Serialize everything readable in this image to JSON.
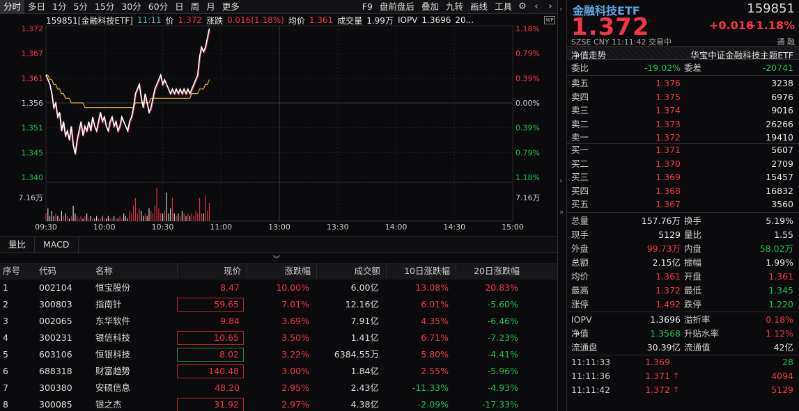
{
  "toolbar": {
    "periods": [
      "分时",
      "多日",
      "1分",
      "5分",
      "15分",
      "30分",
      "60分",
      "日",
      "周",
      "月",
      "更多"
    ],
    "tools": [
      "F9",
      "盘前盘后",
      "叠加",
      "九转",
      "画线",
      "工具"
    ]
  },
  "info": {
    "code_name": "159851[金融科技ETF]",
    "time": "11:11",
    "price_label": "价",
    "price": "1.372",
    "chg_label": "涨跌",
    "chg": "0.016(1.18%)",
    "avg_label": "均价",
    "avg": "1.361",
    "vol_label": "成交量",
    "vol": "1.99万",
    "iopv_label": "IOPV",
    "iopv": "1.3696",
    "extra": "20..."
  },
  "chart_data": {
    "type": "line",
    "x_ticks": [
      "09:30",
      "10:00",
      "10:30",
      "11:00",
      "13:00",
      "13:30",
      "14:00",
      "14:30",
      "15:00"
    ],
    "y_left_ticks": [
      "1.372",
      "1.367",
      "1.361",
      "1.356",
      "1.351",
      "1.345",
      "1.340"
    ],
    "y_right_ticks": [
      "1.18%",
      "0.79%",
      "0.39%",
      "0.00%",
      "0.39%",
      "0.79%",
      "1.18%"
    ],
    "vol_tick": "7.16万",
    "ylim": [
      1.34,
      1.372
    ],
    "price": [
      1.362,
      1.361,
      1.36,
      1.358,
      1.355,
      1.356,
      1.353,
      1.354,
      1.35,
      1.352,
      1.349,
      1.35,
      1.348,
      1.351,
      1.347,
      1.345,
      1.348,
      1.35,
      1.352,
      1.349,
      1.351,
      1.35,
      1.352,
      1.35,
      1.353,
      1.351,
      1.35,
      1.352,
      1.354,
      1.352,
      1.353,
      1.351,
      1.35,
      1.352,
      1.353,
      1.351,
      1.352,
      1.35,
      1.351,
      1.353,
      1.352,
      1.351,
      1.35,
      1.352,
      1.353,
      1.355,
      1.358,
      1.359,
      1.36,
      1.357,
      1.355,
      1.358,
      1.356,
      1.354,
      1.355,
      1.357,
      1.359,
      1.36,
      1.361,
      1.362,
      1.36,
      1.361,
      1.36,
      1.359,
      1.358,
      1.359,
      1.358,
      1.359,
      1.358,
      1.359,
      1.358,
      1.359,
      1.358,
      1.359,
      1.358,
      1.359,
      1.36,
      1.361,
      1.362,
      1.366,
      1.368,
      1.367,
      1.368,
      1.37,
      1.372
    ],
    "avg": [
      1.362,
      1.362,
      1.361,
      1.361,
      1.36,
      1.36,
      1.359,
      1.359,
      1.358,
      1.358,
      1.357,
      1.357,
      1.357,
      1.356,
      1.356,
      1.356,
      1.356,
      1.356,
      1.356,
      1.356,
      1.355,
      1.355,
      1.355,
      1.355,
      1.355,
      1.355,
      1.355,
      1.355,
      1.355,
      1.355,
      1.355,
      1.355,
      1.355,
      1.355,
      1.355,
      1.355,
      1.355,
      1.355,
      1.355,
      1.355,
      1.355,
      1.355,
      1.355,
      1.355,
      1.355,
      1.355,
      1.356,
      1.356,
      1.356,
      1.356,
      1.356,
      1.356,
      1.356,
      1.356,
      1.357,
      1.357,
      1.357,
      1.357,
      1.357,
      1.357,
      1.357,
      1.357,
      1.357,
      1.357,
      1.357,
      1.357,
      1.357,
      1.357,
      1.357,
      1.357,
      1.357,
      1.357,
      1.357,
      1.357,
      1.357,
      1.358,
      1.358,
      1.358,
      1.358,
      1.359,
      1.359,
      1.359,
      1.36,
      1.36,
      1.361
    ],
    "vol": [
      0.3,
      0.5,
      0.2,
      0.4,
      0.2,
      0.3,
      0.2,
      0.1,
      0.4,
      0.2,
      0.3,
      0.2,
      0.1,
      0.2,
      0.6,
      0.3,
      0.2,
      0.1,
      0.2,
      0.1,
      0.2,
      0.3,
      0.1,
      0.2,
      0.1,
      0.1,
      0.2,
      0.1,
      0.1,
      0.2,
      0.1,
      0.1,
      0.2,
      0.1,
      0.1,
      0.2,
      0.1,
      0.1,
      0.2,
      0.1,
      0.3,
      0.2,
      0.1,
      0.4,
      0.3,
      0.6,
      0.9,
      0.3,
      0.5,
      0.4,
      0.2,
      0.3,
      0.2,
      0.5,
      0.4,
      0.3,
      0.6,
      1.3,
      0.5,
      0.3,
      0.3,
      0.4,
      1.1,
      0.3,
      0.5,
      0.9,
      0.3,
      0.2,
      0.3,
      0.2,
      0.4,
      0.3,
      0.2,
      0.3,
      0.2,
      0.3,
      0.2,
      0.4,
      0.3,
      0.9,
      0.3,
      0.3,
      1.0,
      0.4,
      0.7
    ]
  },
  "indicator_tabs": [
    "量比",
    "MACD"
  ],
  "table": {
    "columns": [
      "序号",
      "代码",
      "名称",
      "现价",
      "涨跌幅",
      "成交额",
      "10日涨跌幅",
      "20日涨跌幅"
    ],
    "rows": [
      {
        "idx": "1",
        "code": "002104",
        "name": "恒宝股份",
        "price": "8.47",
        "chg": "10.00%",
        "amt": "6.00亿",
        "d10": "13.08%",
        "d20": "20.83%",
        "box": "none"
      },
      {
        "idx": "2",
        "code": "300803",
        "name": "指南针",
        "price": "59.65",
        "chg": "7.01%",
        "amt": "12.16亿",
        "d10": "6.01%",
        "d20": "-5.60%",
        "box": "red"
      },
      {
        "idx": "3",
        "code": "002065",
        "name": "东华软件",
        "price": "9.84",
        "chg": "3.69%",
        "amt": "7.91亿",
        "d10": "4.35%",
        "d20": "-6.46%",
        "box": "none"
      },
      {
        "idx": "4",
        "code": "300231",
        "name": "银信科技",
        "price": "10.65",
        "chg": "3.50%",
        "amt": "1.41亿",
        "d10": "6.71%",
        "d20": "-7.23%",
        "box": "red"
      },
      {
        "idx": "5",
        "code": "603106",
        "name": "恒银科技",
        "price": "8.02",
        "chg": "3.22%",
        "amt": "6384.55万",
        "d10": "5.80%",
        "d20": "-4.41%",
        "box": "green"
      },
      {
        "idx": "6",
        "code": "688318",
        "name": "财富趋势",
        "price": "140.48",
        "chg": "3.00%",
        "amt": "1.84亿",
        "d10": "2.55%",
        "d20": "-5.96%",
        "box": "red"
      },
      {
        "idx": "7",
        "code": "300380",
        "name": "安硕信息",
        "price": "48.20",
        "chg": "2.95%",
        "amt": "2.43亿",
        "d10": "-11.33%",
        "d20": "-4.93%",
        "box": "none"
      },
      {
        "idx": "8",
        "code": "300085",
        "name": "银之杰",
        "price": "31.92",
        "chg": "2.97%",
        "amt": "4.38亿",
        "d10": "-2.09%",
        "d20": "-17.33%",
        "box": "red"
      }
    ]
  },
  "quote": {
    "name": "金融科技ETF",
    "code": "159851",
    "price": "1.372",
    "chg": "+0.016",
    "chg_pct": "+1.18%",
    "meta": "SZSE  CNY  11:11:42  交易中",
    "tong": "通  融",
    "nav_label": "净值走势",
    "index_name": "华宝中证金融科技主题ETF",
    "wb_label": "委比",
    "wb": "-19.02%",
    "wc_label": "委差",
    "wc": "-20741",
    "asks": [
      {
        "label": "卖五",
        "price": "1.376",
        "vol": "3238"
      },
      {
        "label": "卖四",
        "price": "1.375",
        "vol": "6976"
      },
      {
        "label": "卖三",
        "price": "1.374",
        "vol": "9016"
      },
      {
        "label": "卖二",
        "price": "1.373",
        "vol": "26266"
      },
      {
        "label": "卖一",
        "price": "1.372",
        "vol": "19410"
      }
    ],
    "bids": [
      {
        "label": "买一",
        "price": "1.371",
        "vol": "5607"
      },
      {
        "label": "买二",
        "price": "1.370",
        "vol": "2709"
      },
      {
        "label": "买三",
        "price": "1.369",
        "vol": "15457"
      },
      {
        "label": "买四",
        "price": "1.368",
        "vol": "16832"
      },
      {
        "label": "买五",
        "price": "1.367",
        "vol": "3560"
      }
    ],
    "stats": [
      {
        "a": "总量",
        "b": "157.76万",
        "bc": "white",
        "c": "换手",
        "d": "5.19%",
        "dc": "white"
      },
      {
        "a": "现手",
        "b": "5129",
        "bc": "white",
        "c": "量比",
        "d": "1.55",
        "dc": "white"
      },
      {
        "a": "外盘",
        "b": "99.73万",
        "bc": "red",
        "c": "内盘",
        "d": "58.02万",
        "dc": "green"
      },
      {
        "a": "总额",
        "b": "2.15亿",
        "bc": "white",
        "c": "振幅",
        "d": "1.99%",
        "dc": "white"
      },
      {
        "a": "均价",
        "b": "1.361",
        "bc": "red",
        "c": "开盘",
        "d": "1.361",
        "dc": "red"
      },
      {
        "a": "最高",
        "b": "1.372",
        "bc": "red",
        "c": "最低",
        "d": "1.345",
        "dc": "green"
      },
      {
        "a": "涨停",
        "b": "1.492",
        "bc": "red",
        "c": "跌停",
        "d": "1.220",
        "dc": "green"
      }
    ],
    "stats2": [
      {
        "a": "IOPV",
        "b": "1.3696",
        "bc": "white",
        "c": "溢折率",
        "d": "0.18%",
        "dc": "red"
      },
      {
        "a": "净值",
        "b": "1.3568",
        "bc": "green",
        "c": "升贴水率",
        "d": "1.12%",
        "dc": "red"
      },
      {
        "a": "流通盘",
        "b": "30.39亿",
        "bc": "white",
        "c": "流通值",
        "d": "42亿",
        "dc": "white"
      }
    ],
    "ticks": [
      {
        "t": "11:11:33",
        "p": "1.369",
        "arrow": "",
        "v": "28",
        "vc": "green"
      },
      {
        "t": "11:11:36",
        "p": "1.371",
        "arrow": "↑",
        "v": "4094",
        "vc": "red"
      },
      {
        "t": "11:11:42",
        "p": "1.372",
        "arrow": "↑",
        "v": "5129",
        "vc": "red"
      }
    ]
  }
}
